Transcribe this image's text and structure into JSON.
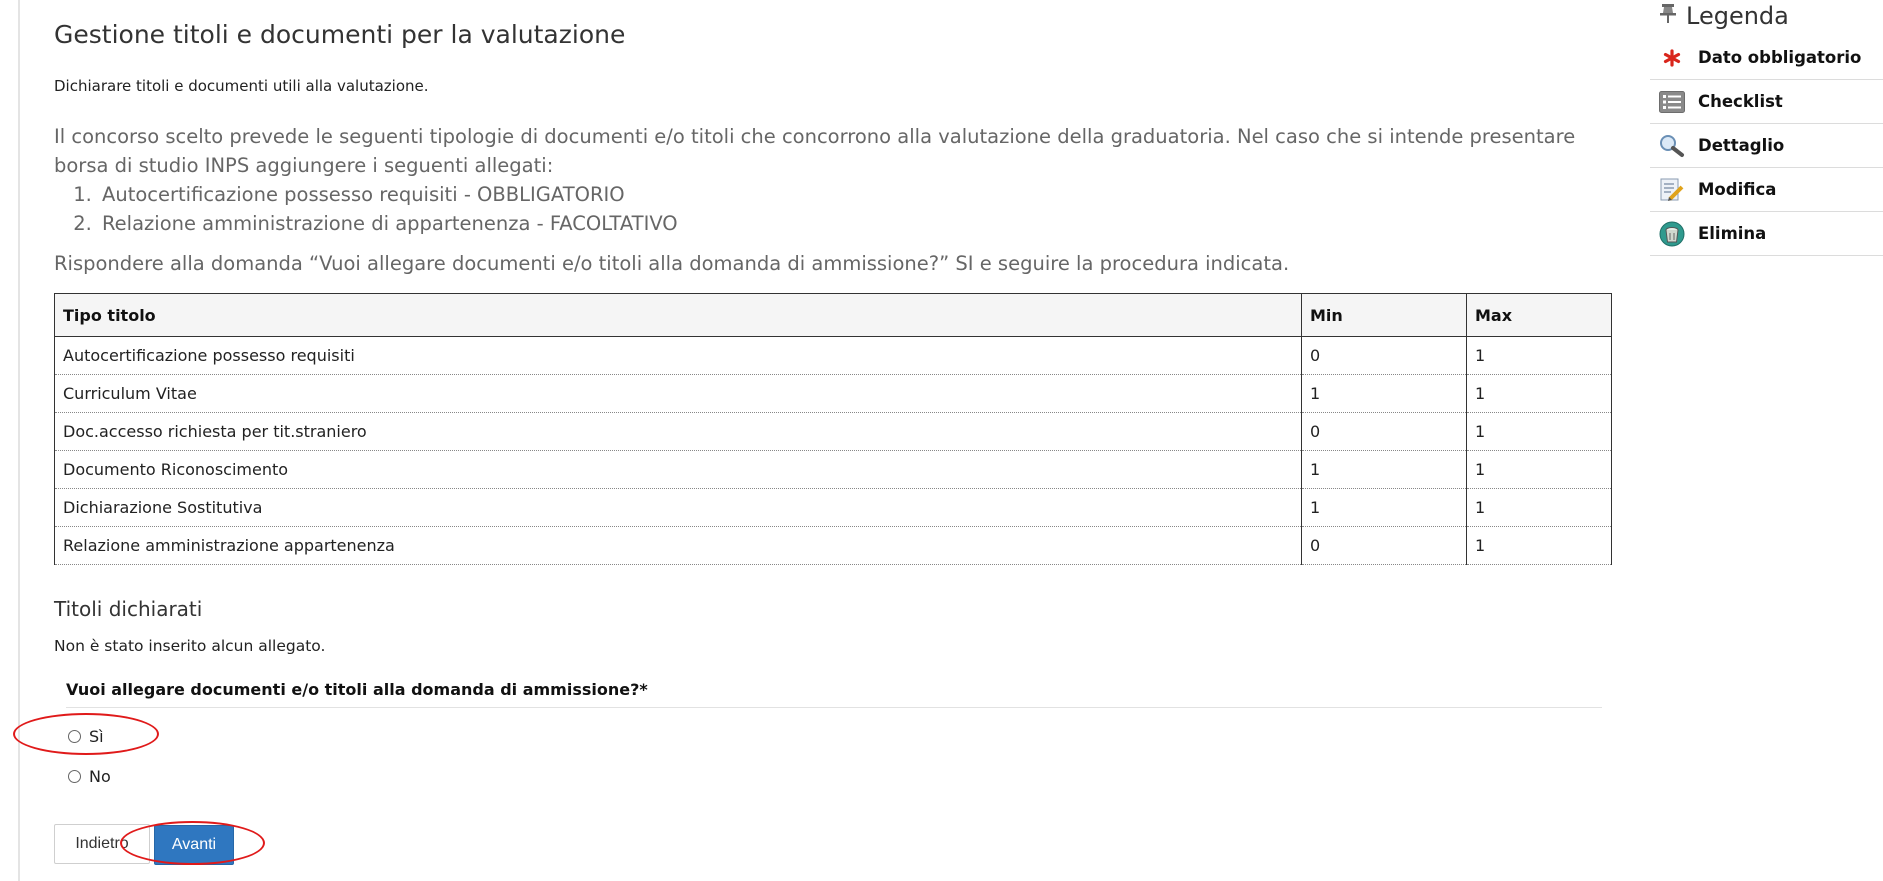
{
  "page": {
    "title": "Gestione titoli e documenti per la valutazione",
    "subtitle": "Dichiarare titoli e documenti utili alla valutazione.",
    "info_text": "Il concorso scelto prevede le seguenti tipologie di documenti e/o titoli che concorrono alla valutazione della graduatoria. Nel caso che si intende presentare borsa di studio INPS aggiungere i seguenti allegati:",
    "info_list": [
      "Autocertificazione possesso requisiti - OBBLIGATORIO",
      "Relazione amministrazione di appartenenza - FACOLTATIVO"
    ],
    "instruction": "Rispondere alla domanda “Vuoi allegare documenti e/o titoli alla domanda di ammissione?” SI e seguire la procedura indicata."
  },
  "table": {
    "headers": [
      "Tipo titolo",
      "Min",
      "Max"
    ],
    "rows": [
      [
        "Autocertificazione possesso requisiti",
        "0",
        "1"
      ],
      [
        "Curriculum Vitae",
        "1",
        "1"
      ],
      [
        "Doc.accesso richiesta per tit.straniero",
        "0",
        "1"
      ],
      [
        "Documento Riconoscimento",
        "1",
        "1"
      ],
      [
        "Dichiarazione Sostitutiva",
        "1",
        "1"
      ],
      [
        "Relazione amministrazione appartenenza",
        "0",
        "1"
      ]
    ]
  },
  "declared": {
    "title": "Titoli dichiarati",
    "empty_text": "Non è stato inserito alcun allegato."
  },
  "form": {
    "question": "Vuoi allegare documenti e/o titoli alla domanda di ammissione?*",
    "options": [
      "Sì",
      "No"
    ]
  },
  "buttons": {
    "back": "Indietro",
    "next": "Avanti"
  },
  "legend": {
    "title": "Legenda",
    "items": [
      {
        "label": "Dato obbligatorio",
        "icon": "asterisk-icon"
      },
      {
        "label": "Checklist",
        "icon": "checklist-icon"
      },
      {
        "label": "Dettaglio",
        "icon": "magnifier-icon"
      },
      {
        "label": "Modifica",
        "icon": "edit-icon"
      },
      {
        "label": "Elimina",
        "icon": "trash-icon"
      }
    ]
  },
  "colors": {
    "primary_button": "#2f77c0",
    "annotation": "#e01a1a",
    "required_star": "#d9261c"
  }
}
